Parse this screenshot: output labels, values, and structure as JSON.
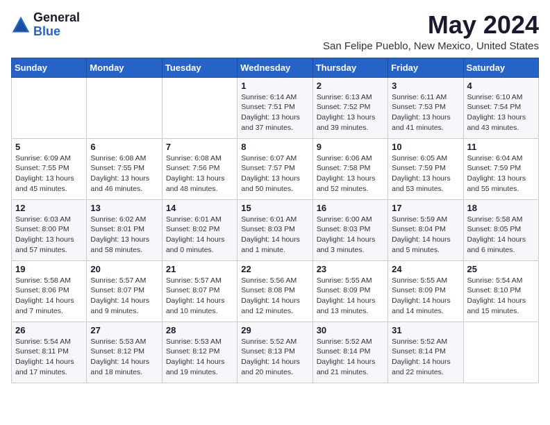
{
  "logo": {
    "general": "General",
    "blue": "Blue"
  },
  "title": {
    "month_year": "May 2024",
    "location": "San Felipe Pueblo, New Mexico, United States"
  },
  "days_of_week": [
    "Sunday",
    "Monday",
    "Tuesday",
    "Wednesday",
    "Thursday",
    "Friday",
    "Saturday"
  ],
  "weeks": [
    [
      {
        "day": "",
        "info": ""
      },
      {
        "day": "",
        "info": ""
      },
      {
        "day": "",
        "info": ""
      },
      {
        "day": "1",
        "info": "Sunrise: 6:14 AM\nSunset: 7:51 PM\nDaylight: 13 hours and 37 minutes."
      },
      {
        "day": "2",
        "info": "Sunrise: 6:13 AM\nSunset: 7:52 PM\nDaylight: 13 hours and 39 minutes."
      },
      {
        "day": "3",
        "info": "Sunrise: 6:11 AM\nSunset: 7:53 PM\nDaylight: 13 hours and 41 minutes."
      },
      {
        "day": "4",
        "info": "Sunrise: 6:10 AM\nSunset: 7:54 PM\nDaylight: 13 hours and 43 minutes."
      }
    ],
    [
      {
        "day": "5",
        "info": "Sunrise: 6:09 AM\nSunset: 7:55 PM\nDaylight: 13 hours and 45 minutes."
      },
      {
        "day": "6",
        "info": "Sunrise: 6:08 AM\nSunset: 7:55 PM\nDaylight: 13 hours and 46 minutes."
      },
      {
        "day": "7",
        "info": "Sunrise: 6:08 AM\nSunset: 7:56 PM\nDaylight: 13 hours and 48 minutes."
      },
      {
        "day": "8",
        "info": "Sunrise: 6:07 AM\nSunset: 7:57 PM\nDaylight: 13 hours and 50 minutes."
      },
      {
        "day": "9",
        "info": "Sunrise: 6:06 AM\nSunset: 7:58 PM\nDaylight: 13 hours and 52 minutes."
      },
      {
        "day": "10",
        "info": "Sunrise: 6:05 AM\nSunset: 7:59 PM\nDaylight: 13 hours and 53 minutes."
      },
      {
        "day": "11",
        "info": "Sunrise: 6:04 AM\nSunset: 7:59 PM\nDaylight: 13 hours and 55 minutes."
      }
    ],
    [
      {
        "day": "12",
        "info": "Sunrise: 6:03 AM\nSunset: 8:00 PM\nDaylight: 13 hours and 57 minutes."
      },
      {
        "day": "13",
        "info": "Sunrise: 6:02 AM\nSunset: 8:01 PM\nDaylight: 13 hours and 58 minutes."
      },
      {
        "day": "14",
        "info": "Sunrise: 6:01 AM\nSunset: 8:02 PM\nDaylight: 14 hours and 0 minutes."
      },
      {
        "day": "15",
        "info": "Sunrise: 6:01 AM\nSunset: 8:03 PM\nDaylight: 14 hours and 1 minute."
      },
      {
        "day": "16",
        "info": "Sunrise: 6:00 AM\nSunset: 8:03 PM\nDaylight: 14 hours and 3 minutes."
      },
      {
        "day": "17",
        "info": "Sunrise: 5:59 AM\nSunset: 8:04 PM\nDaylight: 14 hours and 5 minutes."
      },
      {
        "day": "18",
        "info": "Sunrise: 5:58 AM\nSunset: 8:05 PM\nDaylight: 14 hours and 6 minutes."
      }
    ],
    [
      {
        "day": "19",
        "info": "Sunrise: 5:58 AM\nSunset: 8:06 PM\nDaylight: 14 hours and 7 minutes."
      },
      {
        "day": "20",
        "info": "Sunrise: 5:57 AM\nSunset: 8:07 PM\nDaylight: 14 hours and 9 minutes."
      },
      {
        "day": "21",
        "info": "Sunrise: 5:57 AM\nSunset: 8:07 PM\nDaylight: 14 hours and 10 minutes."
      },
      {
        "day": "22",
        "info": "Sunrise: 5:56 AM\nSunset: 8:08 PM\nDaylight: 14 hours and 12 minutes."
      },
      {
        "day": "23",
        "info": "Sunrise: 5:55 AM\nSunset: 8:09 PM\nDaylight: 14 hours and 13 minutes."
      },
      {
        "day": "24",
        "info": "Sunrise: 5:55 AM\nSunset: 8:09 PM\nDaylight: 14 hours and 14 minutes."
      },
      {
        "day": "25",
        "info": "Sunrise: 5:54 AM\nSunset: 8:10 PM\nDaylight: 14 hours and 15 minutes."
      }
    ],
    [
      {
        "day": "26",
        "info": "Sunrise: 5:54 AM\nSunset: 8:11 PM\nDaylight: 14 hours and 17 minutes."
      },
      {
        "day": "27",
        "info": "Sunrise: 5:53 AM\nSunset: 8:12 PM\nDaylight: 14 hours and 18 minutes."
      },
      {
        "day": "28",
        "info": "Sunrise: 5:53 AM\nSunset: 8:12 PM\nDaylight: 14 hours and 19 minutes."
      },
      {
        "day": "29",
        "info": "Sunrise: 5:52 AM\nSunset: 8:13 PM\nDaylight: 14 hours and 20 minutes."
      },
      {
        "day": "30",
        "info": "Sunrise: 5:52 AM\nSunset: 8:14 PM\nDaylight: 14 hours and 21 minutes."
      },
      {
        "day": "31",
        "info": "Sunrise: 5:52 AM\nSunset: 8:14 PM\nDaylight: 14 hours and 22 minutes."
      },
      {
        "day": "",
        "info": ""
      }
    ]
  ]
}
